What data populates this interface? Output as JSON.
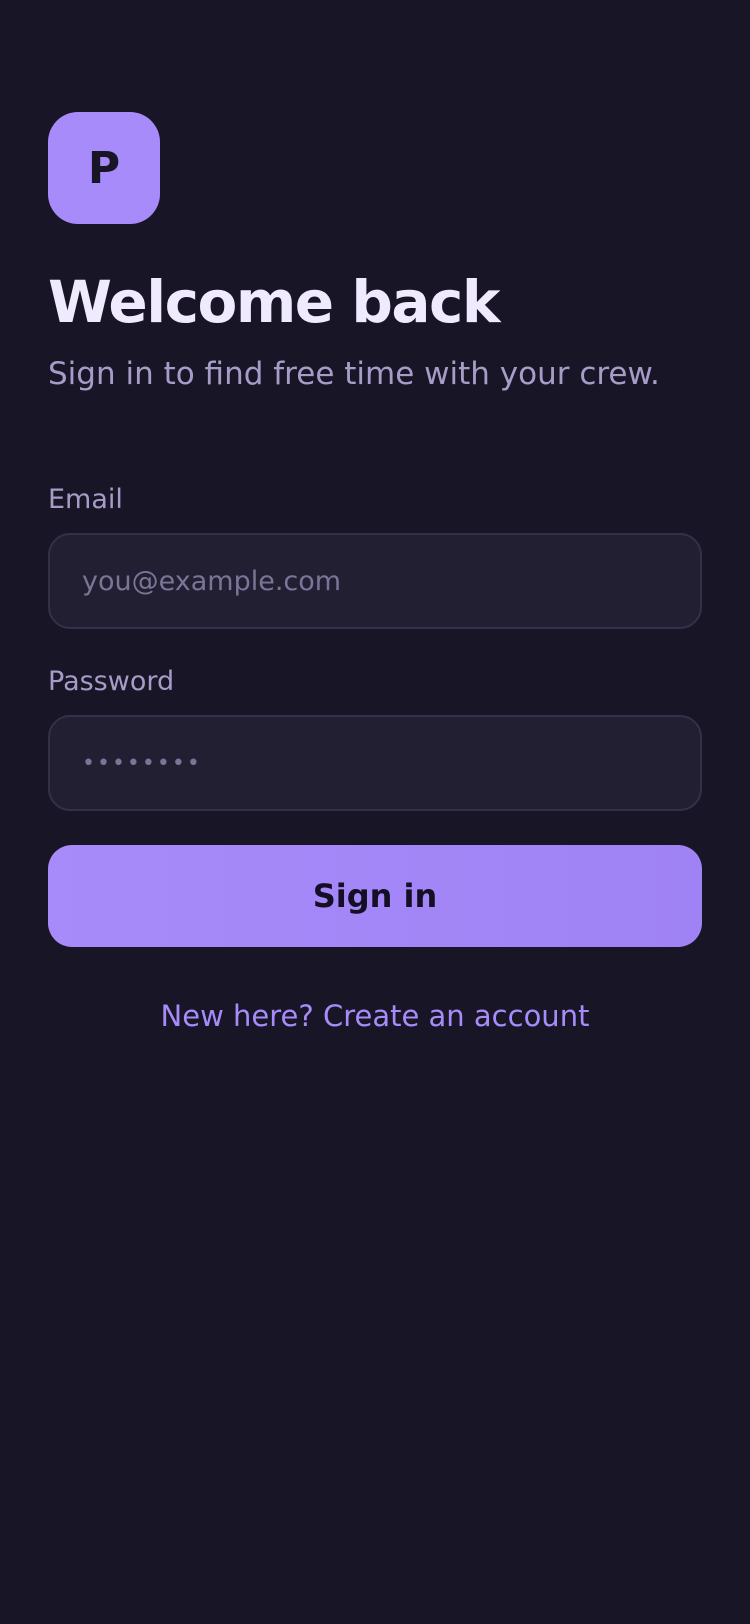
{
  "brand": {
    "logo_letter": "P",
    "accent_color": "#a78bfa"
  },
  "header": {
    "title": "Welcome back",
    "subtitle": "Sign in to find free time with your crew."
  },
  "form": {
    "email": {
      "label": "Email",
      "placeholder": "you@example.com",
      "value": ""
    },
    "password": {
      "label": "Password",
      "placeholder": "••••••••",
      "value": ""
    },
    "submit_label": "Sign in"
  },
  "footer": {
    "signup_link": "New here? Create an account"
  },
  "colors": {
    "background": "#181626",
    "field_background": "#221f33",
    "field_border": "#35304a",
    "title_text": "#efeafd",
    "muted_text": "#a79cc7"
  }
}
